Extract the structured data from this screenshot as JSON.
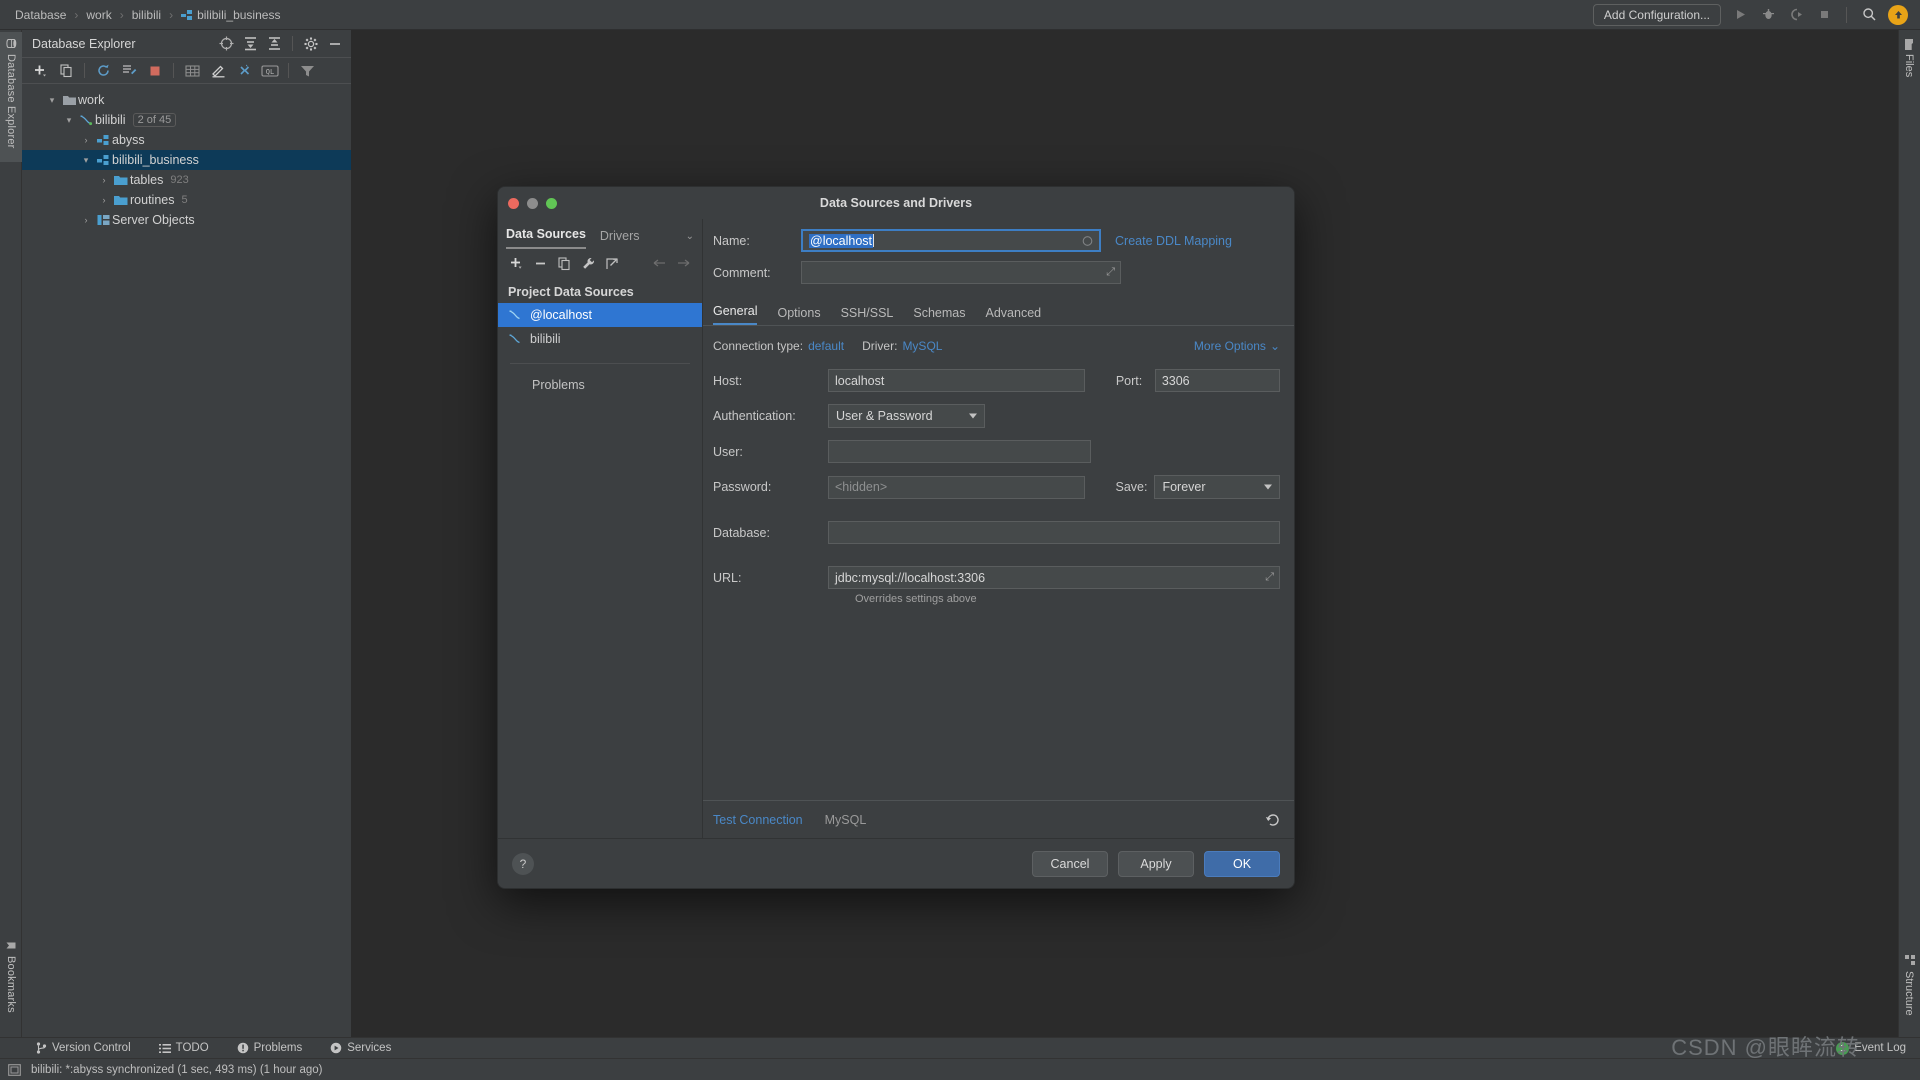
{
  "topbar": {
    "breadcrumbs": [
      "Database",
      "work",
      "bilibili",
      "bilibili_business"
    ],
    "add_configuration": "Add Configuration...",
    "icons": [
      "run-icon",
      "debug-icon",
      "run-with-coverage-icon",
      "stop-icon",
      "search-everywhere-icon",
      "update-avatar-icon"
    ]
  },
  "left_strip": {
    "database_explorer": "Database Explorer",
    "bookmarks": "Bookmarks"
  },
  "right_strip": {
    "files": "Files",
    "structure": "Structure"
  },
  "db_panel": {
    "title": "Database Explorer",
    "head_icons": [
      "locate-icon",
      "expand-all-icon",
      "collapse-all-icon",
      "settings-icon",
      "hide-icon"
    ],
    "toolbar_icons": [
      "add-icon",
      "copy-icon",
      "refresh-icon",
      "sync-icon",
      "stop-icon",
      "table-icon",
      "edit-icon",
      "jump-icon",
      "query-console-icon",
      "filter-icon"
    ],
    "tree": [
      {
        "label": "work",
        "badge": "",
        "depth": 0,
        "twist": "expanded",
        "icon": "folder-icon",
        "selected": false
      },
      {
        "label": "bilibili",
        "badge": "2 of 45",
        "badge_boxed": true,
        "depth": 1,
        "twist": "expanded",
        "icon": "mysql-icon",
        "selected": false
      },
      {
        "label": "abyss",
        "badge": "",
        "depth": 2,
        "twist": "collapsed",
        "icon": "schema-icon",
        "selected": false
      },
      {
        "label": "bilibili_business",
        "badge": "",
        "depth": 2,
        "twist": "expanded",
        "icon": "schema-icon",
        "selected": true
      },
      {
        "label": "tables",
        "badge": "923",
        "depth": 3,
        "twist": "collapsed",
        "icon": "folder-blue-icon",
        "selected": false
      },
      {
        "label": "routines",
        "badge": "5",
        "depth": 3,
        "twist": "collapsed",
        "icon": "folder-blue-icon",
        "selected": false
      },
      {
        "label": "Server Objects",
        "badge": "",
        "depth": 2,
        "twist": "collapsed",
        "icon": "server-icon",
        "selected": false
      }
    ]
  },
  "dialog": {
    "title": "Data Sources and Drivers",
    "left": {
      "tabs": [
        {
          "label": "Data Sources",
          "active": true
        },
        {
          "label": "Drivers",
          "active": false
        }
      ],
      "toolbar_icons": [
        "add-icon",
        "remove-icon",
        "duplicate-icon",
        "wrench-icon",
        "share-icon",
        "back-icon",
        "forward-icon"
      ],
      "group_title": "Project Data Sources",
      "items": [
        {
          "label": "@localhost",
          "icon": "mysql-icon",
          "selected": true
        },
        {
          "label": "bilibili",
          "icon": "mysql-icon",
          "selected": false
        }
      ],
      "problems": "Problems"
    },
    "name_label": "Name:",
    "name_value": "@localhost",
    "comment_label": "Comment:",
    "comment_value": "",
    "create_ddl_mapping": "Create DDL Mapping",
    "tabs": [
      {
        "label": "General",
        "active": true
      },
      {
        "label": "Options",
        "active": false
      },
      {
        "label": "SSH/SSL",
        "active": false
      },
      {
        "label": "Schemas",
        "active": false
      },
      {
        "label": "Advanced",
        "active": false
      }
    ],
    "general": {
      "connection_type_label": "Connection type:",
      "connection_type_value": "default",
      "driver_label": "Driver:",
      "driver_value": "MySQL",
      "more_options": "More Options",
      "host_label": "Host:",
      "host_value": "localhost",
      "port_label": "Port:",
      "port_value": "3306",
      "auth_label": "Authentication:",
      "auth_value": "User & Password",
      "user_label": "User:",
      "user_value": "",
      "password_label": "Password:",
      "password_placeholder": "<hidden>",
      "save_label": "Save:",
      "save_value": "Forever",
      "database_label": "Database:",
      "database_value": "",
      "url_label": "URL:",
      "url_value": "jdbc:mysql://localhost:3306",
      "url_hint": "Overrides settings above"
    },
    "footer": {
      "test_connection": "Test Connection",
      "driver_name": "MySQL",
      "revert_icon": "revert-icon"
    },
    "actions": {
      "help": "?",
      "cancel": "Cancel",
      "apply": "Apply",
      "ok": "OK"
    }
  },
  "bottom_bar": {
    "items": [
      {
        "label": "Version Control",
        "icon": "branch-icon"
      },
      {
        "label": "TODO",
        "icon": "list-icon"
      },
      {
        "label": "Problems",
        "icon": "warning-icon"
      },
      {
        "label": "Services",
        "icon": "play-circle-icon"
      }
    ],
    "event_log": "Event Log",
    "event_log_count": "1"
  },
  "status_bar": {
    "icon": "console-icon",
    "text": "bilibili: *:abyss synchronized (1 sec, 493 ms) (1 hour ago)"
  },
  "watermark": "CSDN @眼眸流转",
  "colors": {
    "accent_blue": "#4a88c7",
    "selection_blue": "#2f76d2",
    "tree_selection": "#0d3a58",
    "panel_bg": "#3c3f41",
    "editor_bg": "#2b2b2b",
    "primary_button": "#3f6ca8"
  }
}
